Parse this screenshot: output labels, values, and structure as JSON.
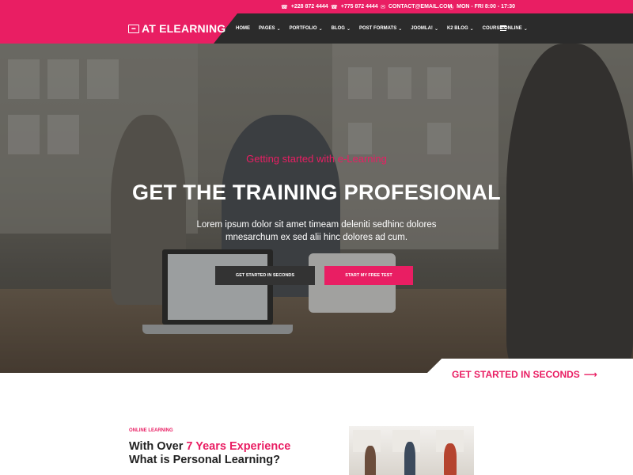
{
  "topbar": {
    "phone1": "+228 872 4444",
    "phone2": "+775 872 4444",
    "email": "CONTACT@EMAIL.COM",
    "hours": "MON - FRI 8:00 - 17:30"
  },
  "header": {
    "logo_text": "AT ELEARNING",
    "nav": [
      "HOME",
      "PAGES",
      "PORTFOLIO",
      "BLOG",
      "POST FORMATS",
      "JOOMLA!",
      "K2 BLOG",
      "COURSE ONLINE"
    ]
  },
  "hero": {
    "subtitle": "Getting started with e-Learning",
    "headline": "GET THE TRAINING PROFESIONAL",
    "lead": "Lorem ipsum dolor sit amet timeam deleniti sedhinc dolores mnesarchum ex sed alii hinc dolores ad cum.",
    "btn_primary": "GET STARTED IN SECONDS",
    "btn_secondary": "START MY FREE TEST",
    "cta": "GET STARTED IN SECONDS"
  },
  "about": {
    "kicker": "ONLINE LEARNING",
    "title_pre": "With Over ",
    "title_accent": "7 Years Experience",
    "title_post": " What is Personal Learning?"
  },
  "colors": {
    "accent": "#e91e63",
    "dark": "#2b2b2b"
  }
}
